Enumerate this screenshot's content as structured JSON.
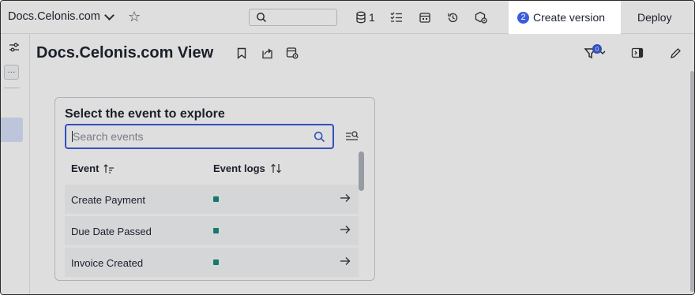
{
  "topbar": {
    "app_title": "Docs.Celonis.com",
    "search_placeholder": "",
    "data_count": "1",
    "create_version_badge": "2",
    "create_version_label": "Create version",
    "deploy_label": "Deploy"
  },
  "view": {
    "title": "Docs.Celonis.com View",
    "filter_count": "0"
  },
  "event_picker": {
    "title": "Select the event to explore",
    "search_placeholder": "Search events",
    "columns": [
      "Event",
      "Event logs"
    ],
    "events": [
      {
        "name": "Create Payment"
      },
      {
        "name": "Due Date Passed"
      },
      {
        "name": "Invoice Created"
      }
    ],
    "event_log_color": "#1b8a83"
  },
  "colors": {
    "accent": "#3b5bdb",
    "selected_rail": "#d8e3fb"
  },
  "icons": {
    "topbar": [
      "chevron-down-icon",
      "star-icon",
      "search-icon",
      "database-icon",
      "checklist-icon",
      "calendar-icon",
      "history-icon",
      "package-settings-icon"
    ],
    "header": [
      "bookmark-icon",
      "share-icon",
      "view-settings-icon",
      "filter-icon",
      "panel-toggle-icon",
      "pencil-icon"
    ],
    "rail": [
      "sliders-icon",
      "more-icon"
    ],
    "card": [
      "search-icon",
      "person-search-icon",
      "sort-asc-icon",
      "sort-icon",
      "arrow-right-icon"
    ]
  }
}
